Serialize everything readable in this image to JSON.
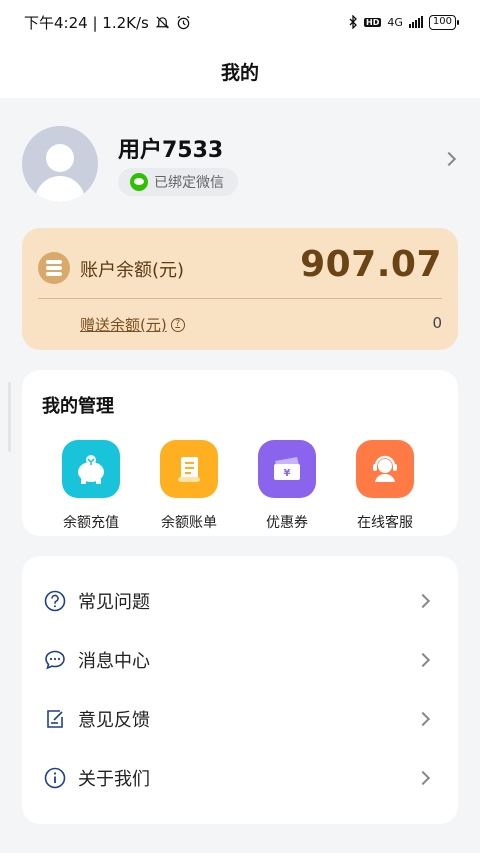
{
  "status_bar": {
    "time_speed": "下午4:24 | 1.2K/s",
    "network": "4G",
    "battery": "100"
  },
  "header": {
    "title": "我的"
  },
  "profile": {
    "username": "用户7533",
    "wechat_status": "已绑定微信"
  },
  "balance": {
    "label": "账户余额(元)",
    "value": "907.07",
    "gift_label": "赠送余额(元)",
    "gift_value": "0"
  },
  "management": {
    "title": "我的管理",
    "items": [
      {
        "label": "余额充值",
        "icon": "piggy-bank-icon",
        "color": "#19c3d9"
      },
      {
        "label": "余额账单",
        "icon": "bill-scroll-icon",
        "color": "#ffb020"
      },
      {
        "label": "优惠券",
        "icon": "coupon-icon",
        "color": "#8a64ec"
      },
      {
        "label": "在线客服",
        "icon": "customer-service-icon",
        "color": "#ff7a45"
      }
    ]
  },
  "menu": {
    "items": [
      {
        "label": "常见问题",
        "icon": "question-icon"
      },
      {
        "label": "消息中心",
        "icon": "message-icon"
      },
      {
        "label": "意见反馈",
        "icon": "feedback-icon"
      },
      {
        "label": "关于我们",
        "icon": "info-icon"
      }
    ]
  }
}
